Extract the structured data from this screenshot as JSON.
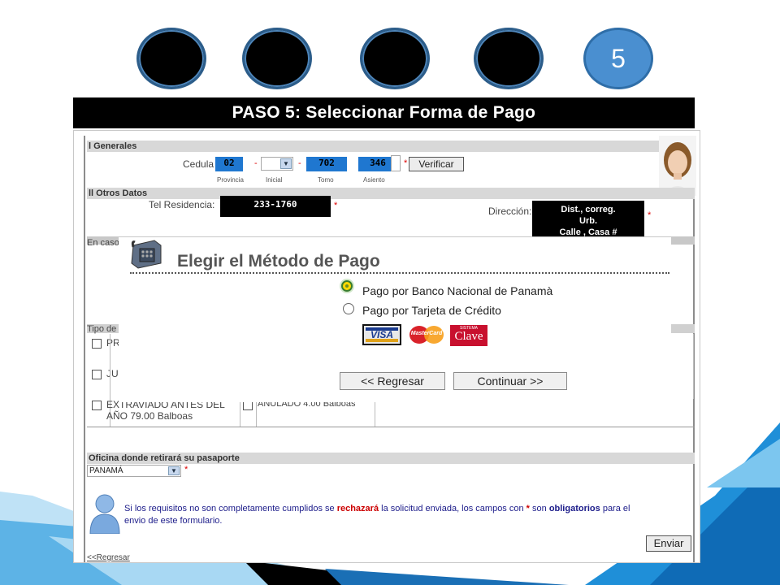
{
  "steps": {
    "active_label": "5"
  },
  "title": "PASO 5:  Seleccionar Forma de Pago",
  "form": {
    "section_general": "l Generales",
    "cedula_label": "Cedula",
    "provincia_value": "02",
    "tomo_value": "702",
    "asiento_value": "346",
    "sub_provincia": "Provincia",
    "sub_inicial": "Inicial",
    "sub_tomo": "Tomo",
    "sub_asiento": "Asiento",
    "verify_button": "Verificar",
    "section_otros": "ll Otros Datos",
    "tel_label": "Tel Residencia:",
    "tel_value": "233-1760",
    "direccion_label": "Dirección:",
    "direccion_value_1": "Dist., correg.",
    "direccion_value_2": "Urb.",
    "direccion_value_3": "Calle , Casa #",
    "en_caso_label": "En caso",
    "tipo_label": "Tipo de",
    "row1_label": "PR",
    "row2_label": "JU",
    "row3_label_1": "EXTRAVIADO ANTES DEL",
    "row3_label_2": "AÑO 79.00 Balboas",
    "anulado_label": "ANULADO 4.00 Balboas",
    "section_oficina": "Oficina donde retirará su pasaporte",
    "oficina_value": "PANAMÁ",
    "notice_pre": "Si los requisitos no son completamente cumplidos se ",
    "notice_red": "rechazará",
    "notice_mid": " la solicitud enviada, los campos con ",
    "notice_star": "*",
    "notice_mid2": " son ",
    "notice_bold": "obligatorios",
    "notice_post": " para el",
    "notice_line2": "envio de este formulario.",
    "send_button": "Enviar",
    "back_link": "<<Regresar"
  },
  "modal": {
    "title": "Elegir el Método de Pago",
    "option_bank": "Pago por Banco Nacional de Panamà",
    "option_card": "Pago por Tarjeta de Crédito",
    "card_visa": "VISA",
    "card_mastercard": "MasterCard",
    "card_clave_small": "SISTEMA",
    "card_clave": "Clave",
    "back_button": "<< Regresar",
    "continue_button": "Continuar >>"
  },
  "colors": {
    "accent_blue": "#1f77d0",
    "step_active": "#4a8fd0",
    "decoration_blue": "#1f8fd8"
  }
}
